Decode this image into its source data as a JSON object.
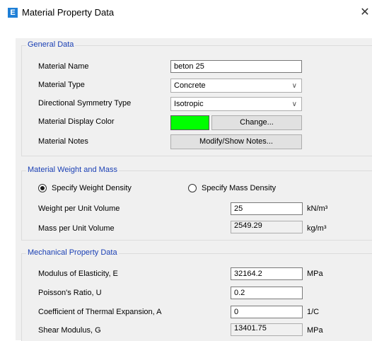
{
  "window": {
    "title": "Material Property Data",
    "app_icon_letter": "E",
    "close_glyph": "✕"
  },
  "general": {
    "legend": "General Data",
    "material_name": {
      "label": "Material Name",
      "value": "beton 25"
    },
    "material_type": {
      "label": "Material Type",
      "value": "Concrete"
    },
    "symmetry_type": {
      "label": "Directional Symmetry Type",
      "value": "Isotropic"
    },
    "display_color": {
      "label": "Material Display Color",
      "color": "#00ff00",
      "button": "Change..."
    },
    "notes": {
      "label": "Material Notes",
      "button": "Modify/Show Notes..."
    }
  },
  "weight_mass": {
    "legend": "Material Weight and Mass",
    "radio_weight": {
      "label": "Specify Weight Density",
      "selected": true
    },
    "radio_mass": {
      "label": "Specify Mass Density",
      "selected": false
    },
    "weight": {
      "label": "Weight per Unit Volume",
      "value": "25",
      "unit": "kN/m³"
    },
    "mass": {
      "label": "Mass per Unit Volume",
      "value": "2549.29",
      "unit": "kg/m³"
    }
  },
  "mechanical": {
    "legend": "Mechanical Property Data",
    "modulus": {
      "label": "Modulus of Elasticity,  E",
      "value": "32164.2",
      "unit": "MPa"
    },
    "poisson": {
      "label": "Poisson's Ratio,  U",
      "value": "0.2"
    },
    "thermal": {
      "label": "Coefficient of Thermal Expansion,  A",
      "value": "0",
      "unit": "1/C"
    },
    "shear": {
      "label": "Shear Modulus,  G",
      "value": "13401.75",
      "unit": "MPa"
    }
  }
}
